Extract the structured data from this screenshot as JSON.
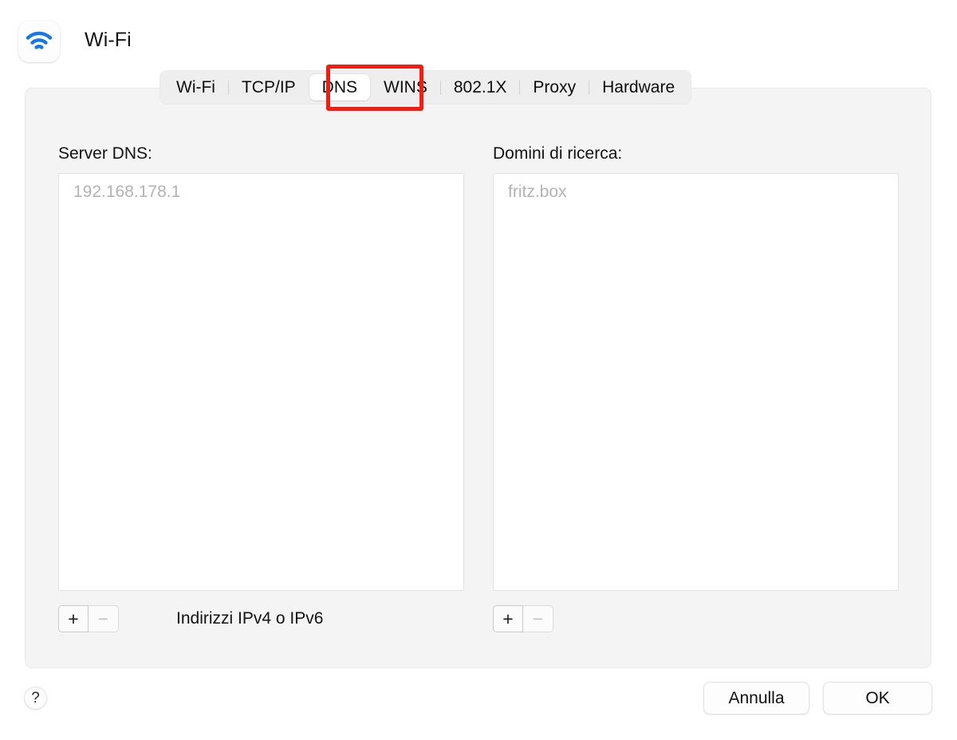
{
  "window": {
    "icon_name": "wifi-icon",
    "title": "Wi-Fi"
  },
  "tabs": [
    {
      "label": "Wi-Fi",
      "selected": false
    },
    {
      "label": "TCP/IP",
      "selected": false
    },
    {
      "label": "DNS",
      "selected": true
    },
    {
      "label": "WINS",
      "selected": false
    },
    {
      "label": "802.1X",
      "selected": false
    },
    {
      "label": "Proxy",
      "selected": false
    },
    {
      "label": "Hardware",
      "selected": false
    }
  ],
  "annotation": {
    "target": "DNS",
    "color": "#f41c10"
  },
  "dns_panel": {
    "servers": {
      "label": "Server DNS:",
      "entries": [
        "192.168.178.1"
      ],
      "add_label": "+",
      "remove_label": "−",
      "caption": "Indirizzi IPv4 o IPv6"
    },
    "search_domains": {
      "label": "Domini di ricerca:",
      "entries": [
        "fritz.box"
      ],
      "add_label": "+",
      "remove_label": "−"
    }
  },
  "footer": {
    "help_label": "?",
    "cancel_label": "Annulla",
    "ok_label": "OK"
  }
}
